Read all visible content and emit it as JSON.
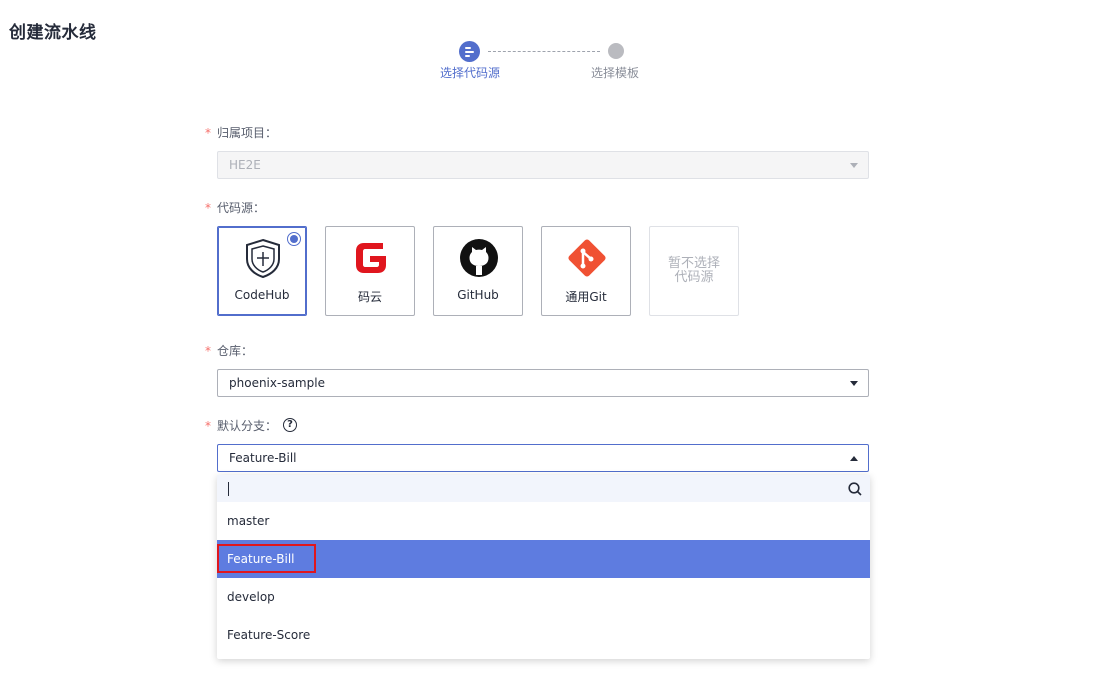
{
  "page": {
    "title": "创建流水线"
  },
  "stepper": {
    "steps": [
      {
        "label": "选择代码源",
        "state": "active"
      },
      {
        "label": "选择模板",
        "state": "pending"
      }
    ]
  },
  "form": {
    "project": {
      "label": "归属项目：",
      "value": "HE2E"
    },
    "source": {
      "label": "代码源：",
      "options": [
        {
          "label": "CodeHub",
          "icon": "codehub-shield-icon",
          "selected": true
        },
        {
          "label": "码云",
          "icon": "gitee-icon",
          "selected": false
        },
        {
          "label": "GitHub",
          "icon": "github-octocat-icon",
          "selected": false
        },
        {
          "label": "通用Git",
          "icon": "git-icon",
          "selected": false
        },
        {
          "label": "暂不选择代码源",
          "label_line1": "暂不选择",
          "label_line2": "代码源",
          "disabled": true
        }
      ]
    },
    "repository": {
      "label": "仓库：",
      "value": "phoenix-sample"
    },
    "branch": {
      "label": "默认分支：",
      "value": "Feature-Bill",
      "search_value": "",
      "options": [
        "master",
        "Feature-Bill",
        "develop",
        "Feature-Score"
      ],
      "selected_index": 1
    }
  },
  "colors": {
    "primary": "#526ecc",
    "selected_row": "#5e7ce0",
    "required": "#f66f6a",
    "highlight": "#e0161e",
    "gitee": "#e0161e",
    "git": "#f05133"
  }
}
